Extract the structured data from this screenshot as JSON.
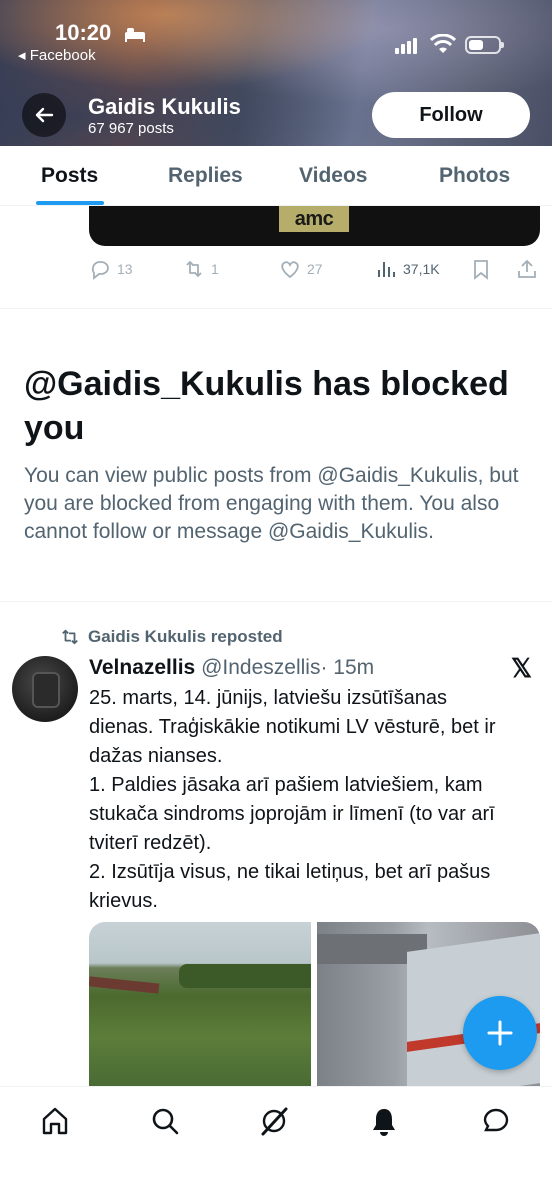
{
  "status_bar": {
    "time": "10:20",
    "back_app": "◂ Facebook"
  },
  "header": {
    "name": "Gaidis Kukulis",
    "posts": "67 967 posts",
    "follow_label": "Follow"
  },
  "tabs": [
    {
      "label": "Posts",
      "active": true
    },
    {
      "label": "Replies"
    },
    {
      "label": "Videos"
    },
    {
      "label": "Photos"
    }
  ],
  "previous_post": {
    "media_logo": "amc",
    "replies": "13",
    "reposts": "1",
    "likes": "27",
    "views": "37,1K"
  },
  "blocked": {
    "title": "@Gaidis_Kukulis has blocked you",
    "description": "You can view public posts from @Gaidis_Kukulis, but you are blocked from engaging with them. You also cannot follow or message @Gaidis_Kukulis."
  },
  "repost": {
    "reposted_by": "Gaidis Kukulis reposted",
    "author_name": "Velnazellis",
    "author_handle": "@Indeszellis",
    "time": "· 15m",
    "lines": [
      "25. marts, 14. jūnijs, latviešu izsūtīšanas",
      "dienas. Traģiskākie notikumi LV vēsturē, bet ir",
      "dažas nianses.",
      "1. Paldies jāsaka arī pašiem latviešiem, kam",
      "stukača sindroms joprojām ir līmenī (to var arī",
      "tviterī redzēt).",
      "2. Izsūtīja visus, ne tikai letiņus, bet arī pašus",
      "krievus."
    ]
  },
  "colors": {
    "accent": "#1d9bf0",
    "text": "#0f1419",
    "muted": "#536471"
  },
  "bottom_nav": [
    "home-icon",
    "search-icon",
    "grok-icon",
    "notifications-icon",
    "messages-icon"
  ]
}
